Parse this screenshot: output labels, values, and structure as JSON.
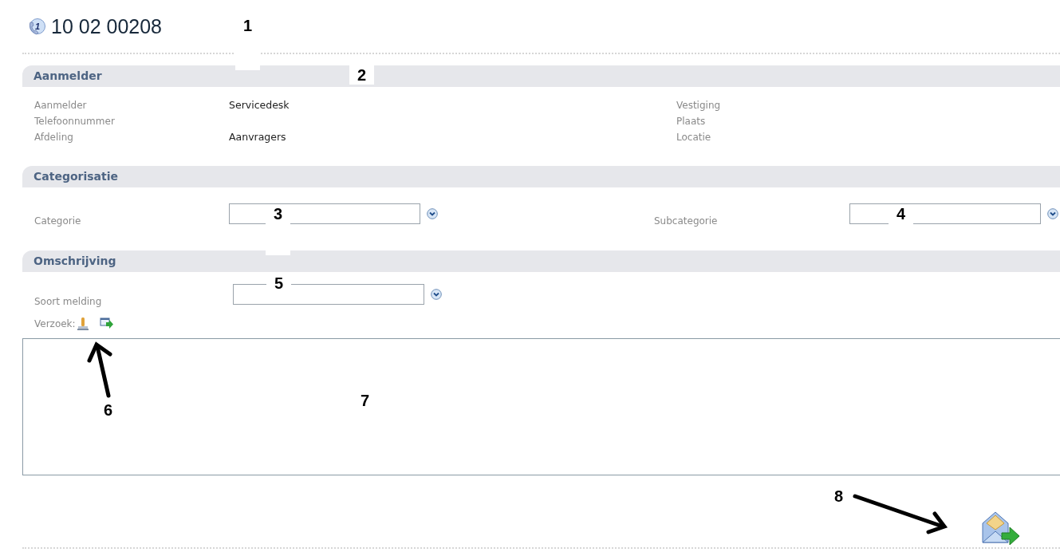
{
  "header": {
    "badge": "1",
    "title": "10 02 00208"
  },
  "sections": [
    {
      "title": "Aanmelder",
      "kind": "info",
      "left": [
        {
          "label": "Aanmelder",
          "value": "Servicedesk"
        },
        {
          "label": "Telefoonnummer"
        },
        {
          "label": "Afdeling",
          "value": "Aanvragers"
        }
      ],
      "right": [
        {
          "label": "Vestiging"
        },
        {
          "label": "Plaats"
        },
        {
          "label": "Locatie"
        }
      ]
    },
    {
      "title": "Categorisatie",
      "kind": "fields",
      "fields": [
        {
          "label": "Categorie"
        },
        {
          "label": "Subcategorie"
        }
      ]
    },
    {
      "title": "Omschrijving",
      "kind": "fields",
      "fields": [
        {
          "label": "Soort melding"
        }
      ]
    }
  ],
  "request": {
    "label": "Verzoek:"
  },
  "annotations": [
    {
      "label": "1"
    },
    {
      "label": "2"
    },
    {
      "label": "3"
    },
    {
      "label": "4"
    },
    {
      "label": "5"
    },
    {
      "label": "6"
    },
    {
      "label": "7"
    },
    {
      "label": "8"
    }
  ]
}
